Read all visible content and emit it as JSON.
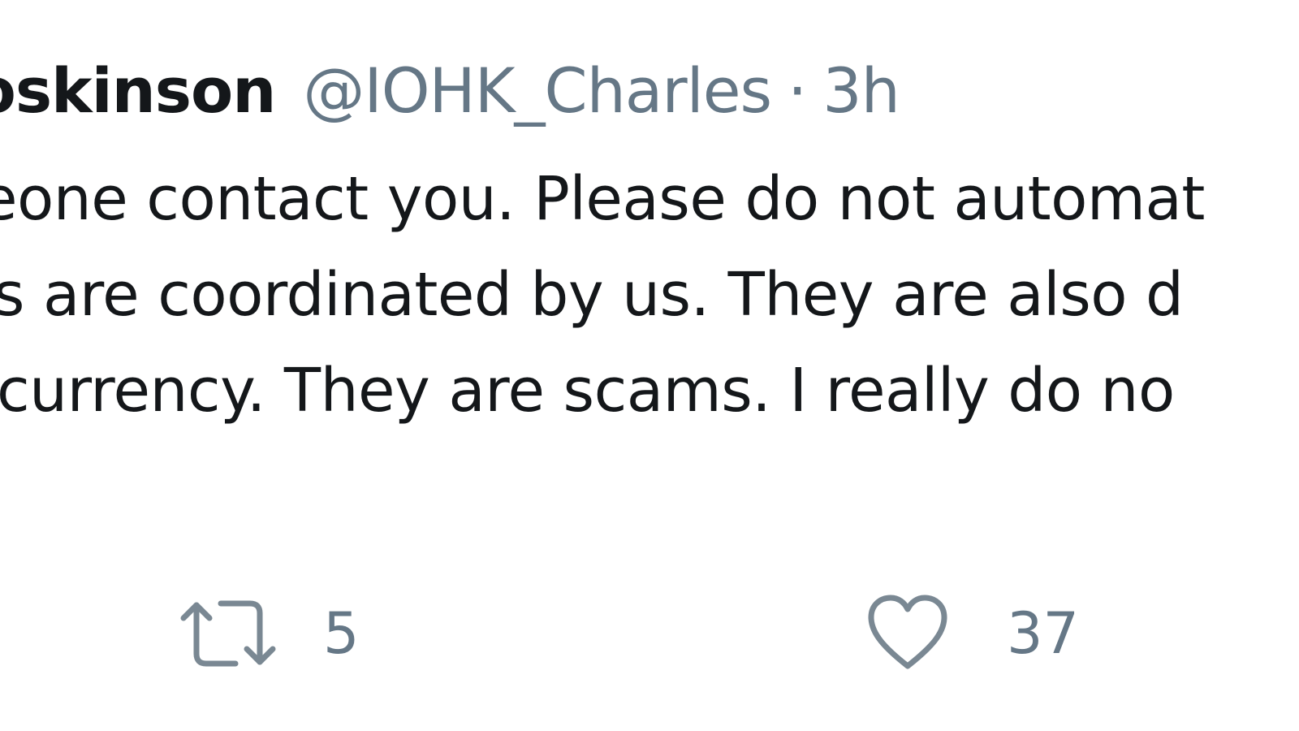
{
  "tweet": {
    "display_name": "Hoskinson",
    "handle": "@IOHK_Charles",
    "separator": "·",
    "time": "3h",
    "body_lines": [
      "eone contact you. Please do not automat",
      "rs are coordinated by us. They are also d",
      "currency. They are scams. I really do no"
    ],
    "retweet_count": "5",
    "like_count": "37"
  },
  "icons": {
    "retweet": "retweet-icon",
    "like": "heart-icon"
  },
  "colors": {
    "text_primary": "#14171a",
    "text_secondary": "#657786",
    "background": "#ffffff"
  }
}
